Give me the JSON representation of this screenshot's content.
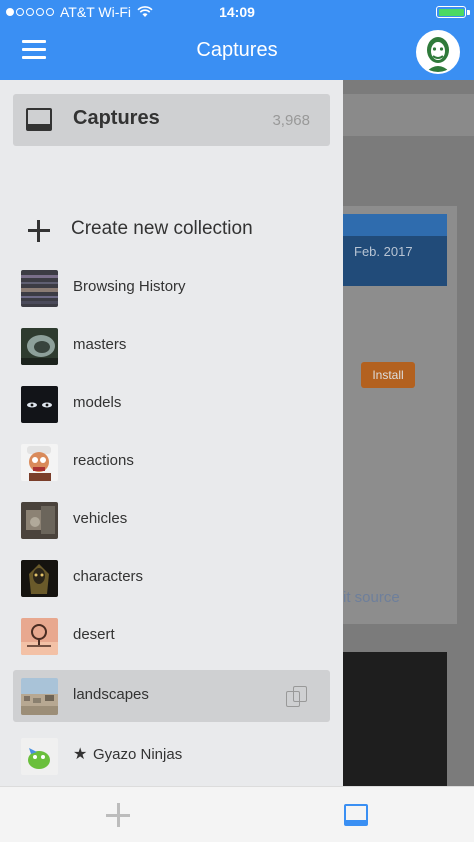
{
  "status_bar": {
    "carrier": "AT&T Wi-Fi",
    "time": "14:09",
    "colors": {
      "accent": "#3a8ff3",
      "battery": "#4cd964"
    }
  },
  "nav": {
    "title": "Captures"
  },
  "background": {
    "date_text": "Feb. 2017",
    "install_label": "Install",
    "source_text": "it source"
  },
  "drawer": {
    "captures": {
      "label": "Captures",
      "count": "3,968"
    },
    "create_label": "Create new collection",
    "collections": [
      {
        "label": "Browsing History",
        "thumb": "browsing-history-thumb"
      },
      {
        "label": "masters",
        "thumb": "masters-thumb"
      },
      {
        "label": "models",
        "thumb": "models-thumb"
      },
      {
        "label": "reactions",
        "thumb": "reactions-thumb"
      },
      {
        "label": "vehicles",
        "thumb": "vehicles-thumb"
      },
      {
        "label": "characters",
        "thumb": "characters-thumb"
      },
      {
        "label": "desert",
        "thumb": "desert-thumb"
      },
      {
        "label": "landscapes",
        "thumb": "landscapes-thumb",
        "selected": true
      },
      {
        "label": "Gyazo Ninjas",
        "thumb": "gyazo-ninjas-thumb",
        "starred": true
      }
    ]
  }
}
